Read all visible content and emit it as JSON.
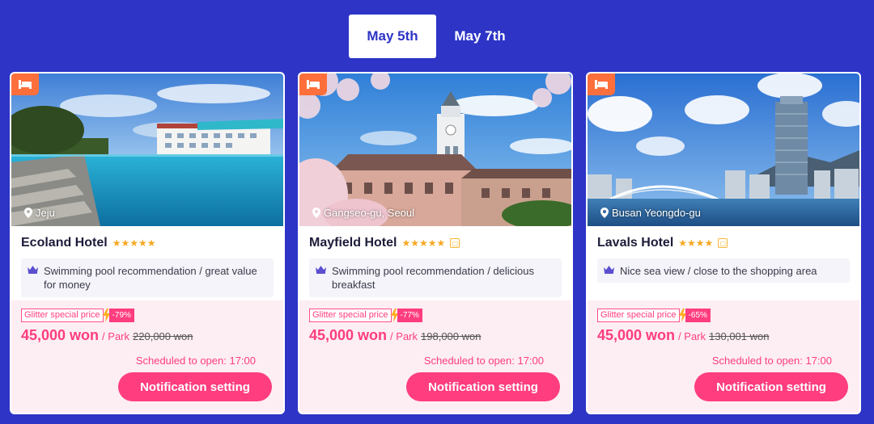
{
  "tabs": [
    {
      "label": "May 5th",
      "active": true
    },
    {
      "label": "May 7th",
      "active": false
    }
  ],
  "colors": {
    "background": "#2d34c6",
    "accent": "#ff3d7f",
    "badge": "#ff6f3c",
    "stars": "#f7a823"
  },
  "hotels": [
    {
      "location": "Jeju",
      "name": "Ecoland Hotel",
      "stars": "★★★★★",
      "recommendation": "Swimming pool recommendation / great value for money",
      "special_label": "Glitter special price",
      "discount": "-79%",
      "price": "45,000 won",
      "park_label": "/ Park",
      "original_price": "220,000 won",
      "open_text": "Scheduled to open: 17:00",
      "button": "Notification setting"
    },
    {
      "location": "Gangseo-gu, Seoul",
      "name": "Mayfield Hotel",
      "stars": "★★★★★",
      "recommendation": "Swimming pool recommendation / delicious breakfast",
      "special_label": "Glitter special price",
      "discount": "-77%",
      "price": "45,000 won",
      "park_label": "/ Park",
      "original_price": "198,000 won",
      "open_text": "Scheduled to open: 17:00",
      "button": "Notification setting"
    },
    {
      "location": "Busan Yeongdo-gu",
      "name": "Lavals Hotel",
      "stars": "★★★★",
      "recommendation": "Nice sea view / close to the shopping area",
      "special_label": "Glitter special price",
      "discount": "-65%",
      "price": "45,000 won",
      "park_label": "/ Park",
      "original_price": "130,001 won",
      "open_text": "Scheduled to open: 17:00",
      "button": "Notification setting"
    }
  ]
}
